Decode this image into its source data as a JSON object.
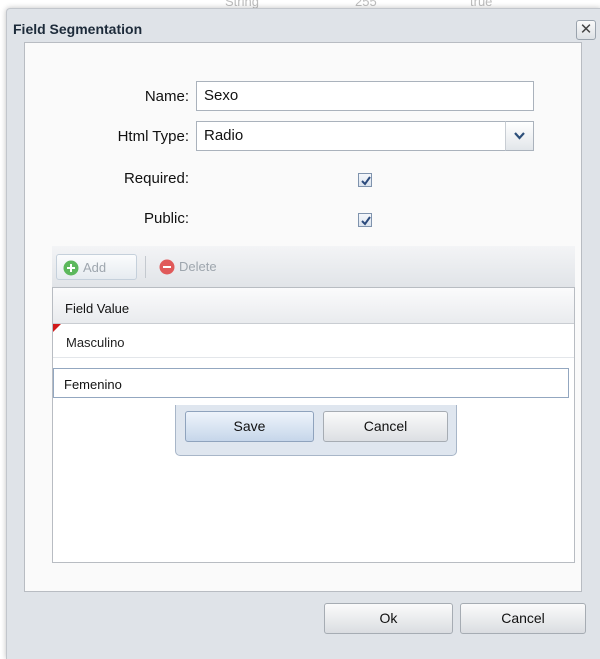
{
  "background_row": [
    "String",
    "255",
    "true"
  ],
  "dialog": {
    "title": "Field Segmentation",
    "close_symbol": "✕"
  },
  "form": {
    "name_label": "Name:",
    "name_value": "Sexo",
    "html_type_label": "Html Type:",
    "html_type_value": "Radio",
    "required_label": "Required:",
    "required_checked": true,
    "public_label": "Public:",
    "public_checked": true
  },
  "toolbar": {
    "add_label": "Add",
    "delete_label": "Delete",
    "add_icon": "plus-circle-icon",
    "delete_icon": "minus-circle-icon"
  },
  "grid": {
    "column_header": "Field Value",
    "rows": [
      "Masculino"
    ],
    "editing_value": "Femenino"
  },
  "row_editor": {
    "save_label": "Save",
    "cancel_label": "Cancel"
  },
  "footer": {
    "ok_label": "Ok",
    "cancel_label": "Cancel"
  },
  "colors": {
    "dirty_marker": "#d11a1a",
    "add_icon": "#5cb85c",
    "delete_icon": "#e05a5a"
  }
}
